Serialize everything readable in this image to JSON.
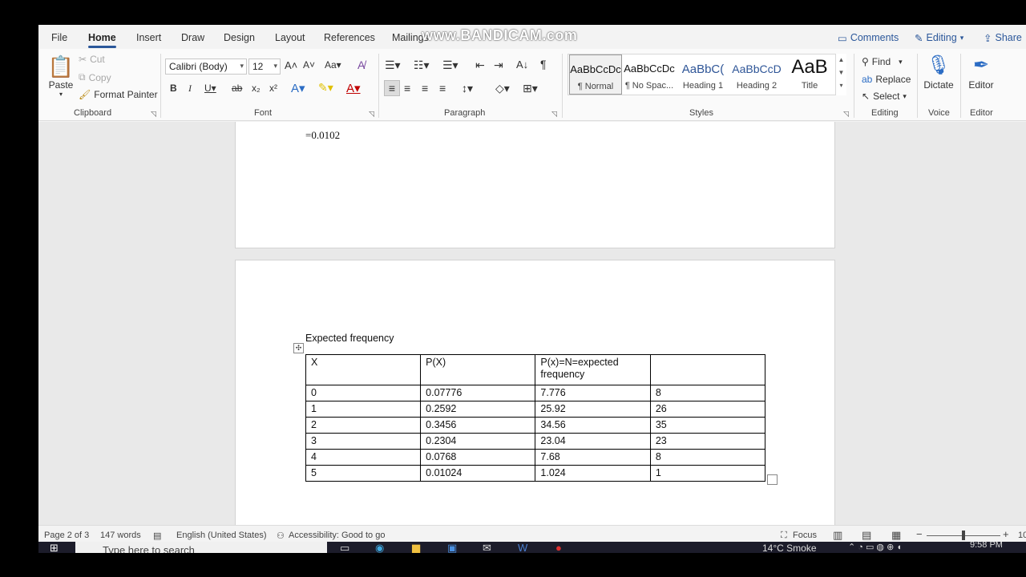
{
  "watermark": "www.BANDICAM.com",
  "menu": {
    "tabs": [
      "File",
      "Home",
      "Insert",
      "Draw",
      "Design",
      "Layout",
      "References",
      "Mailings"
    ],
    "comments": "Comments",
    "editing": "Editing",
    "share": "Share"
  },
  "clipboard": {
    "paste": "Paste",
    "cut": "Cut",
    "copy": "Copy",
    "format_painter": "Format Painter",
    "label": "Clipboard"
  },
  "font": {
    "family": "Calibri (Body)",
    "size": "12",
    "label": "Font"
  },
  "paragraph": {
    "label": "Paragraph"
  },
  "styles": {
    "label": "Styles",
    "items": [
      {
        "preview": "AaBbCcDc",
        "name": "¶ Normal"
      },
      {
        "preview": "AaBbCcDc",
        "name": "¶ No Spac..."
      },
      {
        "preview": "AaBbC(",
        "name": "Heading 1"
      },
      {
        "preview": "AaBbCcD",
        "name": "Heading 2"
      },
      {
        "preview": "AaB",
        "name": "Title"
      }
    ]
  },
  "editing_group": {
    "find": "Find",
    "replace": "Replace",
    "select": "Select",
    "label": "Editing"
  },
  "voice": {
    "dictate": "Dictate",
    "label": "Voice"
  },
  "editor": {
    "editor": "Editor",
    "label": "Editor"
  },
  "document": {
    "page1_text": "=0.0102",
    "heading": "Expected frequency",
    "table": {
      "header": [
        "X",
        "P(X)",
        "P(x)=N=expected frequency",
        ""
      ],
      "rows": [
        [
          "0",
          "0.07776",
          "7.776",
          "8"
        ],
        [
          "1",
          "0.2592",
          "25.92",
          "26"
        ],
        [
          "2",
          "0.3456",
          "34.56",
          "35"
        ],
        [
          "3",
          "0.2304",
          "23.04",
          "23"
        ],
        [
          "4",
          "0.0768",
          "7.68",
          "8"
        ],
        [
          "5",
          "0.01024",
          "1.024",
          "1"
        ]
      ]
    }
  },
  "status": {
    "page": "Page 2 of 3",
    "words": "147 words",
    "language": "English (United States)",
    "accessibility": "Accessibility: Good to go",
    "focus": "Focus",
    "zoom": "10"
  },
  "taskbar": {
    "search_placeholder": "Type here to search",
    "weather": "14°C  Smoke",
    "time": "9:58 PM"
  }
}
